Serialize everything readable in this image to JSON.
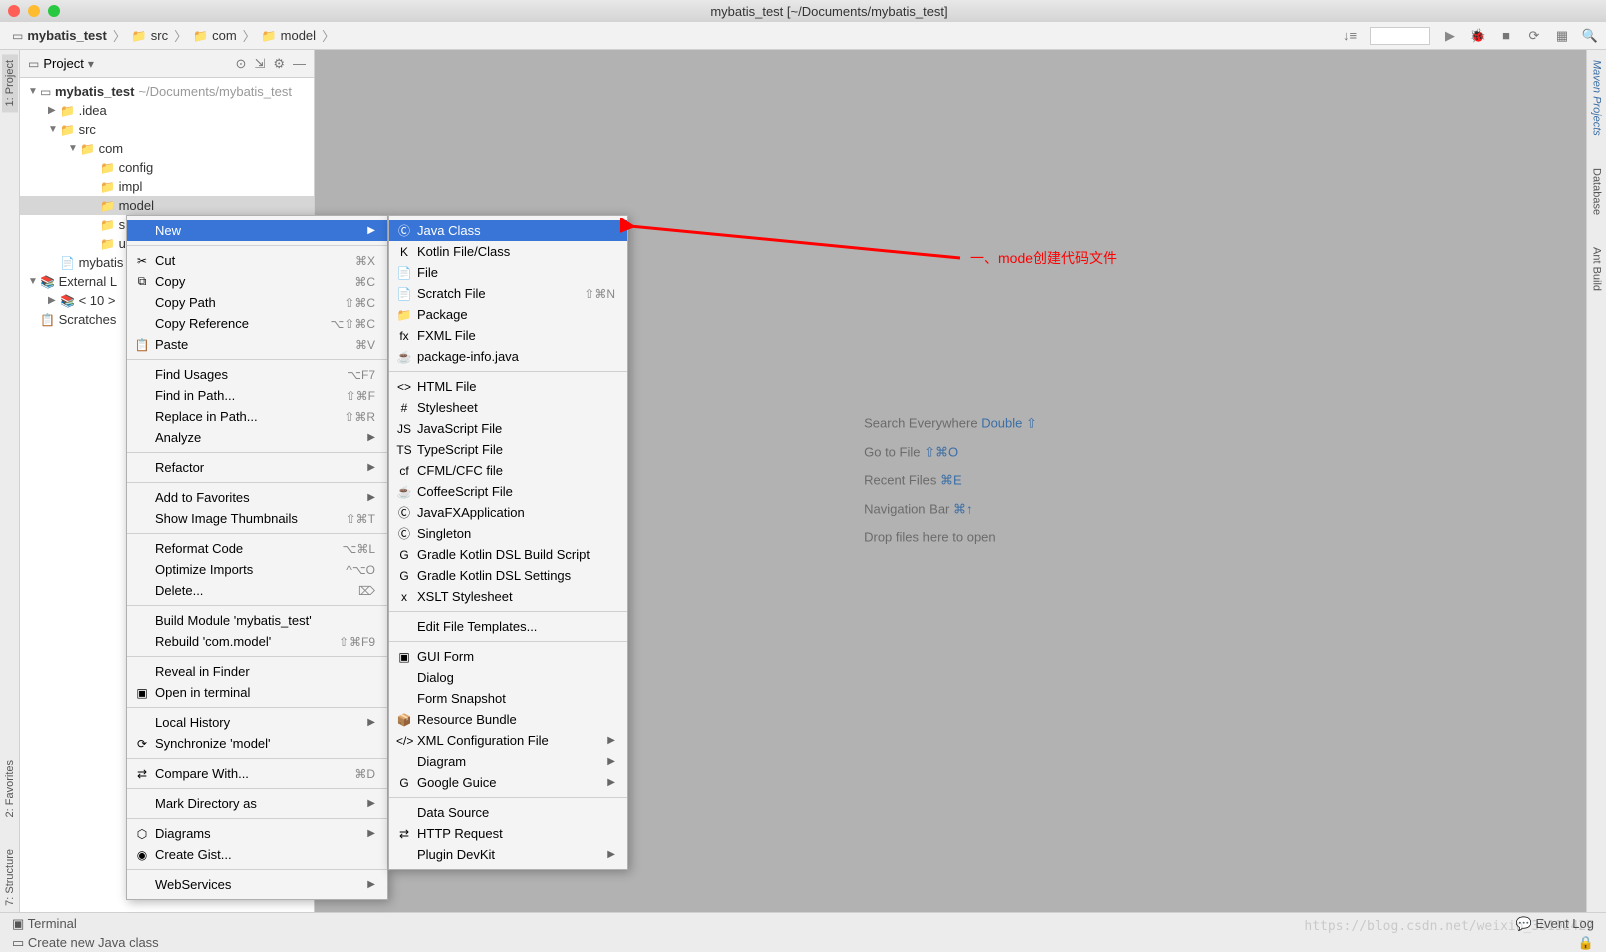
{
  "window": {
    "title": "mybatis_test [~/Documents/mybatis_test]"
  },
  "breadcrumb": {
    "items": [
      {
        "label": "mybatis_test",
        "icon": "module"
      },
      {
        "label": "src",
        "icon": "folder"
      },
      {
        "label": "com",
        "icon": "folder"
      },
      {
        "label": "model",
        "icon": "folder"
      }
    ]
  },
  "project_panel": {
    "title": "Project"
  },
  "tree": {
    "root": {
      "label": "mybatis_test",
      "path": "~/Documents/mybatis_test"
    },
    "idea": ".idea",
    "src": "src",
    "com": "com",
    "config": "config",
    "impl": "impl",
    "model": "model",
    "s_cut": "s",
    "u_cut": "u",
    "mybatis_iml": "mybatis",
    "external_libs": "External L",
    "ten": "< 10 >",
    "scratches": "Scratches"
  },
  "context_menu": {
    "new": "New",
    "cut": "Cut",
    "cut_sc": "⌘X",
    "copy": "Copy",
    "copy_sc": "⌘C",
    "copy_path": "Copy Path",
    "copy_path_sc": "⇧⌘C",
    "copy_reference": "Copy Reference",
    "copy_reference_sc": "⌥⇧⌘C",
    "paste": "Paste",
    "paste_sc": "⌘V",
    "find_usages": "Find Usages",
    "find_usages_sc": "⌥F7",
    "find_in_path": "Find in Path...",
    "find_in_path_sc": "⇧⌘F",
    "replace_in_path": "Replace in Path...",
    "replace_in_path_sc": "⇧⌘R",
    "analyze": "Analyze",
    "refactor": "Refactor",
    "add_to_favorites": "Add to Favorites",
    "show_image_thumbnails": "Show Image Thumbnails",
    "show_image_thumbnails_sc": "⇧⌘T",
    "reformat_code": "Reformat Code",
    "reformat_code_sc": "⌥⌘L",
    "optimize_imports": "Optimize Imports",
    "optimize_imports_sc": "^⌥O",
    "delete": "Delete...",
    "delete_sc": "⌦",
    "build_module": "Build Module 'mybatis_test'",
    "rebuild": "Rebuild 'com.model'",
    "rebuild_sc": "⇧⌘F9",
    "reveal_in_finder": "Reveal in Finder",
    "open_in_terminal": "Open in terminal",
    "local_history": "Local History",
    "synchronize": "Synchronize 'model'",
    "compare_with": "Compare With...",
    "compare_with_sc": "⌘D",
    "mark_directory_as": "Mark Directory as",
    "diagrams": "Diagrams",
    "create_gist": "Create Gist...",
    "webservices": "WebServices"
  },
  "new_submenu": {
    "java_class": "Java Class",
    "kotlin_file": "Kotlin File/Class",
    "file": "File",
    "scratch_file": "Scratch File",
    "scratch_file_sc": "⇧⌘N",
    "package": "Package",
    "fxml_file": "FXML File",
    "package_info": "package-info.java",
    "html_file": "HTML File",
    "stylesheet": "Stylesheet",
    "javascript_file": "JavaScript File",
    "typescript_file": "TypeScript File",
    "cfml_file": "CFML/CFC file",
    "coffeescript_file": "CoffeeScript File",
    "javafx_app": "JavaFXApplication",
    "singleton": "Singleton",
    "gradle_build": "Gradle Kotlin DSL Build Script",
    "gradle_settings": "Gradle Kotlin DSL Settings",
    "xslt_stylesheet": "XSLT Stylesheet",
    "edit_file_templates": "Edit File Templates...",
    "gui_form": "GUI Form",
    "dialog": "Dialog",
    "form_snapshot": "Form Snapshot",
    "resource_bundle": "Resource Bundle",
    "xml_config": "XML Configuration File",
    "diagram": "Diagram",
    "google_guice": "Google Guice",
    "data_source": "Data Source",
    "http_request": "HTTP Request",
    "plugin_devkit": "Plugin DevKit"
  },
  "welcome": {
    "search_everywhere": "Search Everywhere",
    "search_everywhere_key": "Double ⇧",
    "goto_file": "Go to File",
    "goto_file_key": "⇧⌘O",
    "recent_files": "Recent Files",
    "recent_files_key": "⌘E",
    "nav_bar": "Navigation Bar",
    "nav_bar_key": "⌘↑",
    "drop_files": "Drop files here to open"
  },
  "left_tabs": {
    "project": "1: Project",
    "favorites": "2: Favorites",
    "structure": "7: Structure"
  },
  "right_tabs": {
    "maven": "Maven Projects",
    "database": "Database",
    "ant": "Ant Build"
  },
  "bottom": {
    "terminal": "Terminal",
    "event_log": "Event Log"
  },
  "status": {
    "text": "Create new Java class"
  },
  "annotation": {
    "text": "一、mode创建代码文件"
  },
  "watermark": "https://blog.csdn.net/weixin_38192427"
}
